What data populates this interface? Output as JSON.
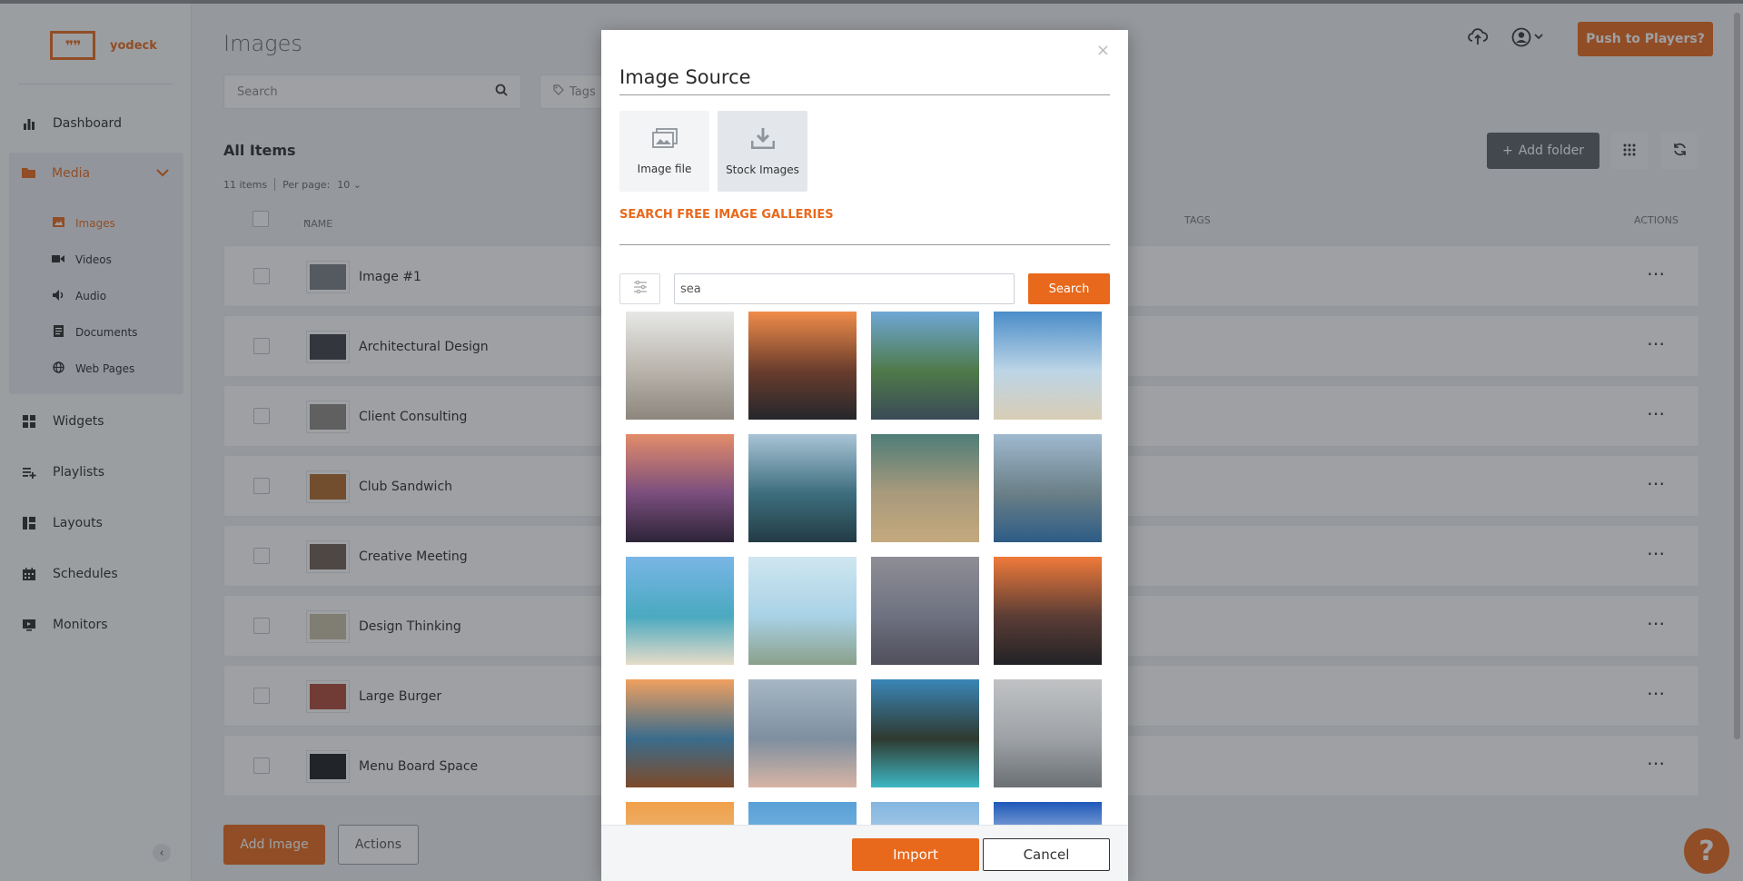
{
  "brand": {
    "name": "yodeck",
    "logo_glyph": "❞❞",
    "accent": "#e8691c"
  },
  "sidebar": {
    "items": [
      {
        "label": "Dashboard",
        "icon": "bar-chart-icon"
      },
      {
        "label": "Media",
        "icon": "folder-icon"
      },
      {
        "label": "Widgets",
        "icon": "widgets-icon"
      },
      {
        "label": "Playlists",
        "icon": "playlist-icon"
      },
      {
        "label": "Layouts",
        "icon": "layouts-icon"
      },
      {
        "label": "Schedules",
        "icon": "calendar-icon"
      },
      {
        "label": "Monitors",
        "icon": "monitor-icon"
      }
    ],
    "media_sub": [
      {
        "label": "Images",
        "icon": "image-icon"
      },
      {
        "label": "Videos",
        "icon": "video-icon"
      },
      {
        "label": "Audio",
        "icon": "audio-icon"
      },
      {
        "label": "Documents",
        "icon": "document-icon"
      },
      {
        "label": "Web Pages",
        "icon": "globe-icon"
      }
    ]
  },
  "header": {
    "title": "Images",
    "search_placeholder": "Search",
    "tags_placeholder": "Tags",
    "push_label": "Push to Players?"
  },
  "list": {
    "heading": "All Items",
    "count": "11 items",
    "per_page_label": "Per page:",
    "per_page_value": "10",
    "add_folder": "Add folder",
    "columns": {
      "name": "NAME",
      "tags": "TAGS",
      "actions": "ACTIONS"
    },
    "rows": [
      {
        "name": "Image #1",
        "thumb": "#7a7f86"
      },
      {
        "name": "Architectural Design",
        "thumb": "#3c3f44"
      },
      {
        "name": "Client Consulting",
        "thumb": "#8d8a84"
      },
      {
        "name": "Club Sandwich",
        "thumb": "#b06a2c"
      },
      {
        "name": "Creative Meeting",
        "thumb": "#6d5e50"
      },
      {
        "name": "Design Thinking",
        "thumb": "#c8c2a6"
      },
      {
        "name": "Large Burger",
        "thumb": "#b04a3a"
      },
      {
        "name": "Menu Board Space",
        "thumb": "#1d1f22"
      }
    ],
    "row_actions": "⋯",
    "add_image": "Add Image",
    "actions": "Actions"
  },
  "modal": {
    "title": "Image Source",
    "close": "×",
    "sources": [
      {
        "label": "Image file",
        "icon": "images-icon"
      },
      {
        "label": "Stock Images",
        "icon": "download-icon"
      }
    ],
    "gallery_link": "SEARCH FREE IMAGE GALLERIES",
    "query": "sea",
    "search_label": "Search",
    "import_label": "Import",
    "cancel_label": "Cancel",
    "images": [
      {
        "colors": [
          "#e7e8e6",
          "#b8b3ab",
          "#8c867d"
        ]
      },
      {
        "colors": [
          "#f08c4a",
          "#6a3d2d",
          "#25262b"
        ]
      },
      {
        "colors": [
          "#6ea7d6",
          "#4f7a4a",
          "#3a4a56"
        ]
      },
      {
        "colors": [
          "#4b8dc9",
          "#bcd5e6",
          "#d8cdb6"
        ]
      },
      {
        "colors": [
          "#e38c6a",
          "#7a4e7d",
          "#2d2438"
        ]
      },
      {
        "colors": [
          "#a9c4d6",
          "#3d6e7e",
          "#233c45"
        ]
      },
      {
        "colors": [
          "#4f7d78",
          "#a99a7c",
          "#c4a97d"
        ]
      },
      {
        "colors": [
          "#9fb9cf",
          "#6a7f86",
          "#2d5c86"
        ]
      },
      {
        "colors": [
          "#79b6e6",
          "#4aa9c0",
          "#e6dcc8"
        ]
      },
      {
        "colors": [
          "#cfe6f0",
          "#a9d2e6",
          "#8aa08b"
        ]
      },
      {
        "colors": [
          "#8e8e96",
          "#6e7180",
          "#504f5c"
        ]
      },
      {
        "colors": [
          "#f07a3a",
          "#5b3d35",
          "#222226"
        ]
      },
      {
        "colors": [
          "#f0a060",
          "#3a6c8c",
          "#7d4a2a"
        ]
      },
      {
        "colors": [
          "#a7b7c4",
          "#7e8fa0",
          "#d6b4a4"
        ]
      },
      {
        "colors": [
          "#3a86b7",
          "#2f3a30",
          "#3db7c3"
        ]
      },
      {
        "colors": [
          "#c0c2c4",
          "#9ea2a6",
          "#6b7075"
        ]
      },
      {
        "colors": [
          "#f0a04a",
          "#e8c08a",
          "#c07a3a"
        ]
      },
      {
        "colors": [
          "#5aa0d6",
          "#86bde6",
          "#c6dcec"
        ]
      },
      {
        "colors": [
          "#84b6e0",
          "#c0d8ec",
          "#e6eef4"
        ]
      },
      {
        "colors": [
          "#1e58b8",
          "#e8f0f8",
          "#5b8ad6"
        ]
      }
    ]
  }
}
